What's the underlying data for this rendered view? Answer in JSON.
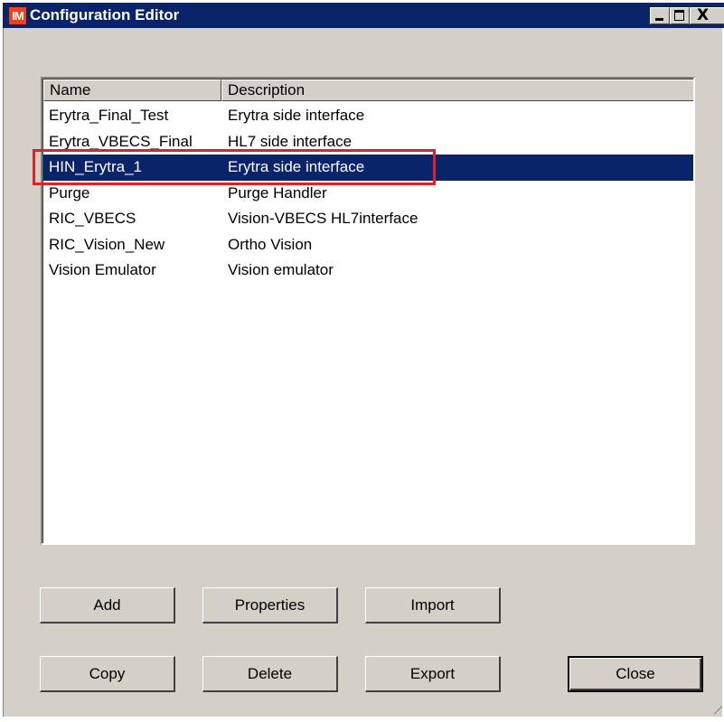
{
  "window": {
    "app_icon": "IM",
    "title": "Configuration Editor",
    "close_glyph": "X"
  },
  "list": {
    "columns": [
      "Name",
      "Description"
    ],
    "rows": [
      {
        "name": "Erytra_Final_Test",
        "description": "Erytra side interface"
      },
      {
        "name": "Erytra_VBECS_Final",
        "description": "HL7 side interface"
      },
      {
        "name": "HIN_Erytra_1",
        "description": "Erytra side interface",
        "selected": true
      },
      {
        "name": "Purge",
        "description": "Purge Handler"
      },
      {
        "name": "RIC_VBECS",
        "description": "Vision-VBECS HL7interface"
      },
      {
        "name": "RIC_Vision_New",
        "description": "Ortho Vision"
      },
      {
        "name": "Vision Emulator",
        "description": "Vision emulator"
      }
    ]
  },
  "buttons": {
    "add": "Add",
    "properties": "Properties",
    "import": "Import",
    "copy": "Copy",
    "delete": "Delete",
    "export": "Export",
    "close": "Close"
  },
  "colors": {
    "titlebar": "#0a246a",
    "selection": "#0a246a",
    "highlight_box": "#e0202a",
    "app_icon": "#e8451e"
  }
}
